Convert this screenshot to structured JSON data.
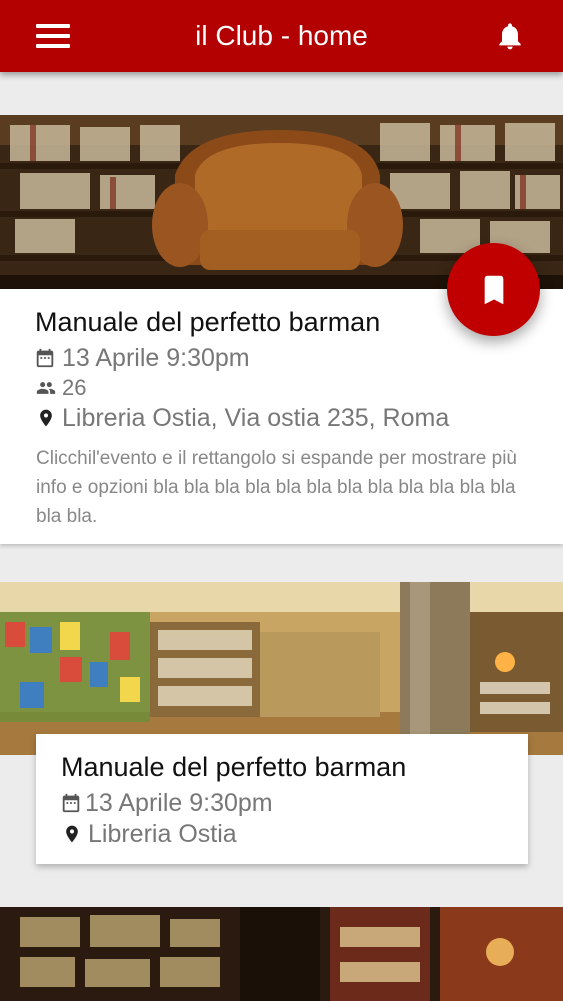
{
  "appbar": {
    "title": "il Club - home",
    "menu_icon": "hamburger-menu-icon",
    "notifications_icon": "bell-icon",
    "color": "#b30000"
  },
  "fab": {
    "icon": "bookmark-icon",
    "color": "#c00000"
  },
  "events": [
    {
      "title": "Manuale del perfetto barman",
      "date": "13 Aprile 9:30pm",
      "attendees": "26",
      "location": "Libreria Ostia, Via ostia 235, Roma",
      "description": "Clicchil'evento e il rettangolo si espande per mostrare più info e opzioni bla bla bla bla bla bla bla bla bla bla bla bla bla bla."
    },
    {
      "title": "Manuale del perfetto barman",
      "date": "13 Aprile 9:30pm",
      "location": "Libreria Ostia"
    }
  ]
}
